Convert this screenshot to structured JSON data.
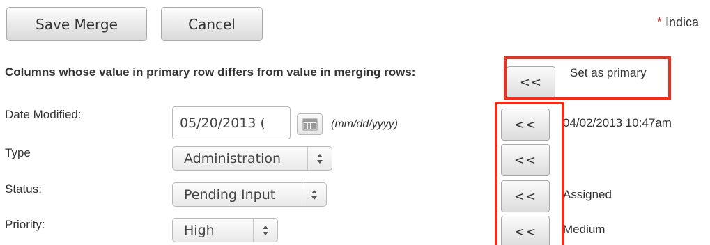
{
  "toolbar": {
    "save_label": "Save Merge",
    "cancel_label": "Cancel"
  },
  "indicator": {
    "star": "*",
    "text": "Indica"
  },
  "section": {
    "heading": "Columns whose value in primary row differs from value in merging rows:",
    "set_primary_button": "<<",
    "set_primary_label": "Set as primary"
  },
  "fields": {
    "date_modified": {
      "label": "Date Modified:",
      "value": "05/20/2013 (",
      "format_hint": "(mm/dd/yyyy)",
      "merge_button": "<<",
      "merge_value": "04/02/2013 10:47am"
    },
    "type": {
      "label": "Type",
      "value": "Administration",
      "merge_button": "<<",
      "merge_value": ""
    },
    "status": {
      "label": "Status:",
      "value": "Pending Input",
      "merge_button": "<<",
      "merge_value": "Assigned"
    },
    "priority": {
      "label": "Priority:",
      "value": "High",
      "merge_button": "<<",
      "merge_value": "Medium"
    }
  },
  "colors": {
    "highlight": "#ef2f1c",
    "required_star": "#e23b2d"
  },
  "icons": {
    "calendar": "calendar-icon",
    "select_arrows": "chevron-updown-icon"
  }
}
